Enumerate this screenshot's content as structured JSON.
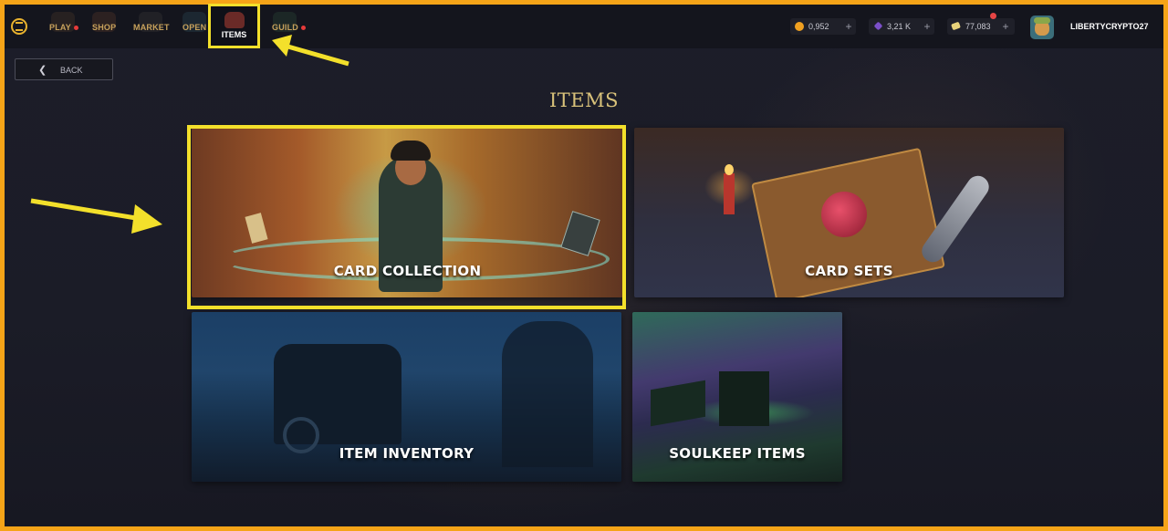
{
  "topbar": {
    "nav": [
      {
        "label": "PLAY",
        "badge": true
      },
      {
        "label": "SHOP",
        "badge": false
      },
      {
        "label": "MARKET",
        "badge": false
      },
      {
        "label": "OPEN",
        "badge": false
      },
      {
        "label": "ITEMS",
        "badge": false,
        "active": true
      },
      {
        "label": "GUILD",
        "badge": true
      }
    ],
    "currencies": [
      {
        "value": "0,952",
        "icon": "coin-icon",
        "color": "#f0a020"
      },
      {
        "value": "3,21 K",
        "icon": "crystal-icon",
        "color": "#7b4fc9"
      },
      {
        "value": "77,083",
        "icon": "ticket-icon",
        "color": "#e8d27a",
        "notification": true
      }
    ],
    "username": "LIBERTYCRYPTO27"
  },
  "back_button": {
    "label": "BACK"
  },
  "page_title": "ITEMS",
  "cards": [
    {
      "label": "CARD COLLECTION",
      "highlighted": true
    },
    {
      "label": "CARD SETS"
    },
    {
      "label": "ITEM INVENTORY"
    },
    {
      "label": "SOULKEEP ITEMS"
    }
  ],
  "colors": {
    "highlight": "#f3e02b",
    "frame": "#f5a418",
    "title": "#d9c27a",
    "nav_text": "#c7a15b"
  }
}
